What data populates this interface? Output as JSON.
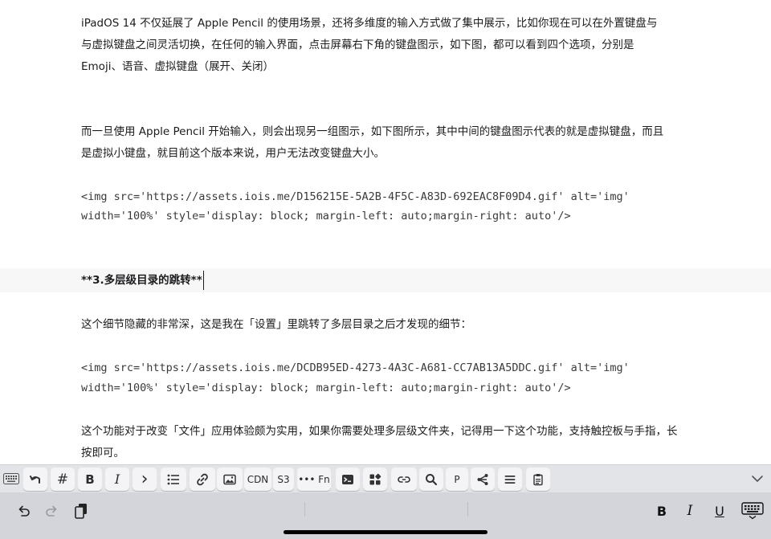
{
  "editor": {
    "lines": [
      "iPadOS 14 不仅延展了 Apple Pencil 的使用场景，还将多维度的输入方式做了集中展示，比如你现在可以在外置键盘与",
      "与虚拟键盘之间灵活切换，在任何的输入界面，点击屏幕右下角的键盘图示，如下图，都可以看到四个选项，分别是",
      "Emoji、语音、虚拟键盘（展开、关闭）",
      "而一旦使用 Apple Pencil 开始输入，则会出现另一组图示，如下图所示，其中中间的键盘图示代表的就是虚拟键盘，而且",
      "是虚拟小键盘，就目前这个版本来说，用户无法改变键盘大小。",
      "<img src='https://assets.iois.me/D156215E-5A2B-4F5C-A83D-692EAC8F09D4.gif' alt='img'",
      "width='100%' style='display: block; margin-left: auto;margin-right: auto'/>",
      "**3.多层级目录的跳转**",
      "这个细节隐藏的非常深，这是我在「设置」里跳转了多层目录之后才发现的细节：",
      "<img src='https://assets.iois.me/DCDB95ED-4273-4A3C-A681-CC7AB13A5DDC.gif' alt='img'",
      "width='100%' style='display: block; margin-left: auto;margin-right: auto'/>",
      "这个功能对于改变「文件」应用体验颇为实用，如果你需要处理多层级文件夹，记得用一下这个功能，支持触控板与手指，长",
      "按即可。"
    ]
  },
  "toolbar": {
    "hash": "#",
    "bold": "B",
    "italic": "I",
    "quote": "›",
    "cdn": "CDN",
    "s3": "S3",
    "fn": "••• Fn",
    "p": "P"
  },
  "shortcuts": {
    "bold": "B",
    "italic": "I",
    "underline": "U"
  }
}
